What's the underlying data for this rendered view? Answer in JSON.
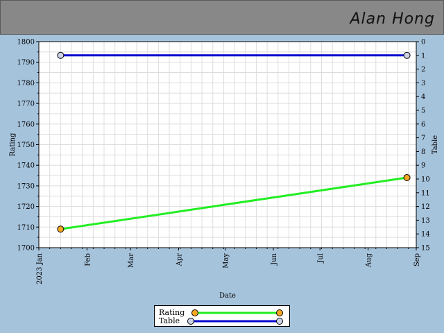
{
  "header": {
    "player_name": "Alan Hong",
    "background": "#888888"
  },
  "chart_data": {
    "type": "line",
    "x_axis": {
      "label": "Date",
      "range": [
        "2023-01-01",
        "2023-09-01"
      ],
      "ticks": [
        {
          "date": "2023-01-01",
          "label": "2023 Jan"
        },
        {
          "date": "2023-02-01",
          "label": "Feb"
        },
        {
          "date": "2023-03-01",
          "label": "Mar"
        },
        {
          "date": "2023-04-01",
          "label": "Apr"
        },
        {
          "date": "2023-05-01",
          "label": "May"
        },
        {
          "date": "2023-06-01",
          "label": "Jun"
        },
        {
          "date": "2023-07-01",
          "label": "Jul"
        },
        {
          "date": "2023-08-01",
          "label": "Aug"
        },
        {
          "date": "2023-09-01",
          "label": "Sep"
        }
      ]
    },
    "y_left": {
      "label": "Rating",
      "range": [
        1700,
        1800
      ],
      "step": 10
    },
    "y_right": {
      "label": "Table",
      "range": [
        0,
        15
      ],
      "step": 1,
      "inverted": true
    },
    "grid": true,
    "legend_position": "bottom-center",
    "series": [
      {
        "name": "Rating",
        "axis": "left",
        "color": "#22ee22",
        "marker": "#f5a623",
        "points": [
          {
            "x": "2023-01-15",
            "y": 1709
          },
          {
            "x": "2023-08-26",
            "y": 1734
          }
        ]
      },
      {
        "name": "Table",
        "axis": "right",
        "color": "#0000cc",
        "marker": "#cdd3e6",
        "points": [
          {
            "x": "2023-01-15",
            "y": 1
          },
          {
            "x": "2023-08-26",
            "y": 1
          }
        ]
      }
    ]
  }
}
